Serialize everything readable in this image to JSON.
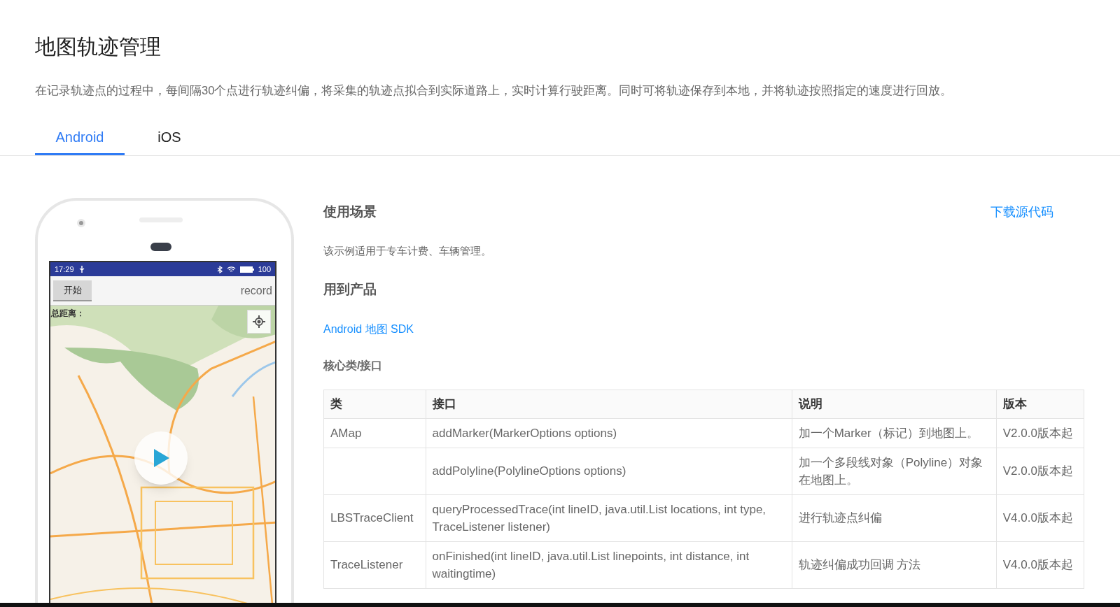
{
  "page": {
    "title": "地图轨迹管理",
    "description": "在记录轨迹点的过程中，每间隔30个点进行轨迹纠偏，将采集的轨迹点拟合到实际道路上，实时计算行驶距离。同时可将轨迹保存到本地，并将轨迹按照指定的速度进行回放。"
  },
  "tabs": [
    {
      "label": "Android",
      "selected": true
    },
    {
      "label": "iOS",
      "selected": false
    }
  ],
  "phone": {
    "status_bar": {
      "time": "17:29",
      "battery": "100"
    },
    "app_bar": {
      "button": "开始",
      "title": "record"
    },
    "map": {
      "distance_label": "总距离："
    }
  },
  "content": {
    "download_link": "下载源代码",
    "scene_heading": "使用场景",
    "scene_text": "该示例适用于专车计费、车辆管理。",
    "products_heading": "用到产品",
    "product_link": "Android 地图 SDK",
    "api_heading": "核心类/接口",
    "table": {
      "columns": [
        "类",
        "接口",
        "说明",
        "版本"
      ],
      "rows": [
        [
          "AMap",
          "addMarker(MarkerOptions options)",
          "加一个Marker（标记）到地图上。",
          "V2.0.0版本起"
        ],
        [
          "",
          "addPolyline(PolylineOptions options)",
          "加一个多段线对象（Polyline）对象在地图上。",
          "V2.0.0版本起"
        ],
        [
          "LBSTraceClient",
          "queryProcessedTrace(int lineID, java.util.List locations, int type, TraceListener listener)",
          "进行轨迹点纠偏",
          "V4.0.0版本起"
        ],
        [
          "TraceListener",
          "onFinished(int lineID, java.util.List linepoints, int distance, int waitingtime)",
          "轨迹纠偏成功回调 方法",
          "V4.0.0版本起"
        ]
      ]
    }
  }
}
